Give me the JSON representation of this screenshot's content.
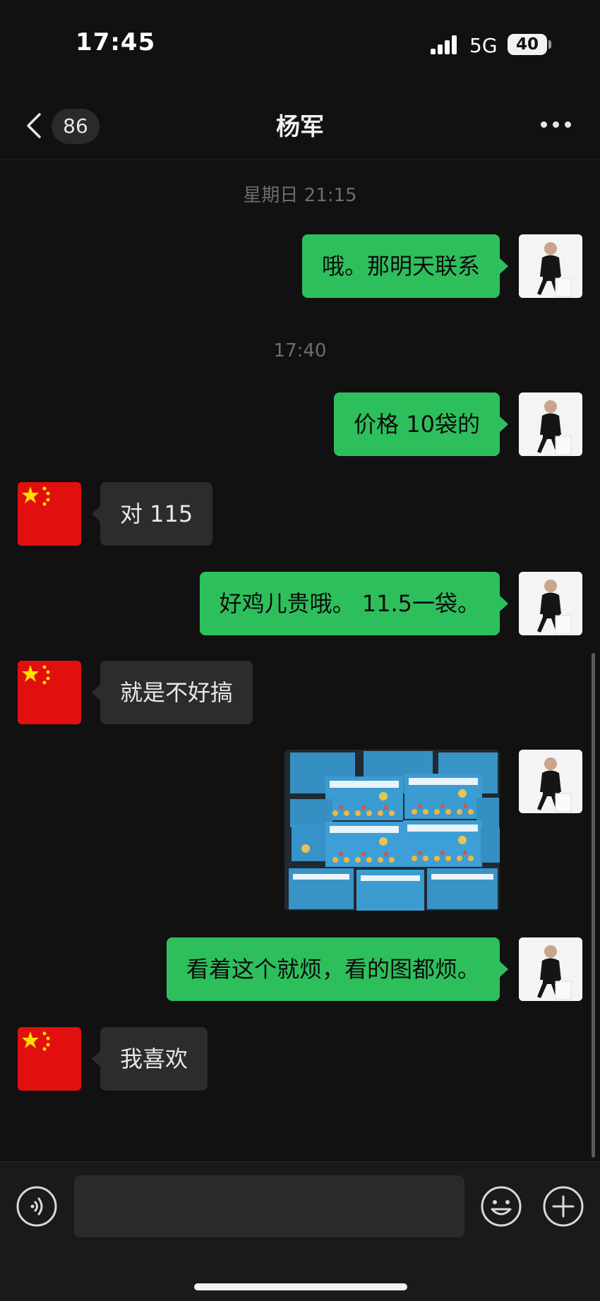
{
  "status_bar": {
    "time": "17:45",
    "network": "5G",
    "battery": "40"
  },
  "nav": {
    "back_icon": "chevron-left-icon",
    "unread_count": "86",
    "title": "杨军",
    "more_icon": "more-dots-icon"
  },
  "messages": [
    {
      "type": "timestamp",
      "text": "星期日 21:15"
    },
    {
      "type": "text",
      "direction": "out",
      "text": "哦。那明天联系"
    },
    {
      "type": "timestamp",
      "text": "17:40"
    },
    {
      "type": "text",
      "direction": "out",
      "text": "价格  10袋的"
    },
    {
      "type": "text",
      "direction": "in",
      "text": "对 115"
    },
    {
      "type": "text",
      "direction": "out",
      "text": "好鸡儿贵哦。    11.5一袋。"
    },
    {
      "type": "text",
      "direction": "in",
      "text": "就是不好搞"
    },
    {
      "type": "image",
      "direction": "out",
      "description_icon": "photo-thumbnail"
    },
    {
      "type": "text",
      "direction": "out",
      "text": "看着这个就烦，看的图都烦。"
    },
    {
      "type": "text",
      "direction": "in",
      "text": "我喜欢"
    }
  ],
  "input_bar": {
    "voice_icon": "voice-icon",
    "placeholder": "",
    "emoji_icon": "emoji-icon",
    "plus_icon": "plus-icon"
  },
  "colors": {
    "background": "#111111",
    "outgoing_bubble": "#2ebf5d",
    "incoming_bubble": "#2c2c2c",
    "flag_red": "#e20f0f",
    "flag_star": "#ffde00"
  }
}
